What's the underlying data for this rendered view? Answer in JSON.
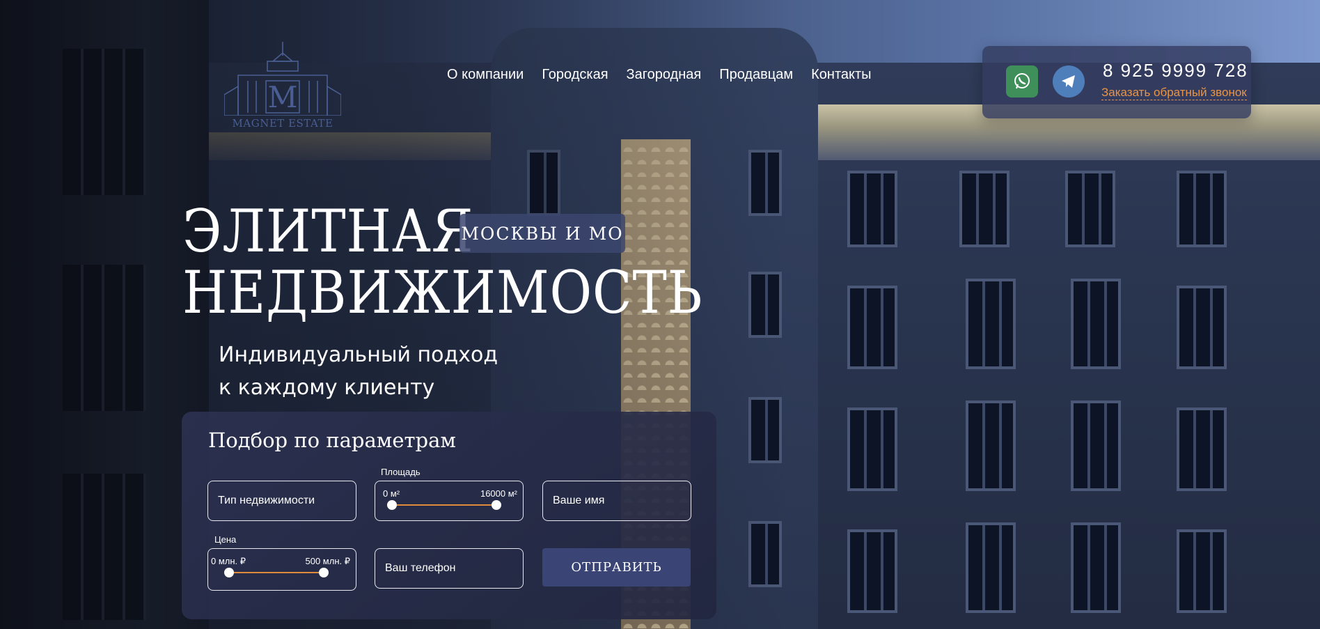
{
  "brand": {
    "logo_text": "MAGNET ESTATE"
  },
  "nav": {
    "items": [
      {
        "label": "О компании"
      },
      {
        "label": "Городская"
      },
      {
        "label": "Загородная"
      },
      {
        "label": "Продавцам"
      },
      {
        "label": "Контакты"
      }
    ]
  },
  "contact": {
    "phone": "8 925 9999 728",
    "callback": "Заказать обратный звонок",
    "icons": [
      "whatsapp-icon",
      "telegram-icon"
    ]
  },
  "hero": {
    "line1": "ЭЛИТНАЯ",
    "line2": "НЕДВИЖИМОСТЬ",
    "badge": "МОСКВЫ И МО",
    "sub1": "Индивидуальный подход",
    "sub2": "к каждому клиенту"
  },
  "filter": {
    "title": "Подбор по параметрам",
    "type_placeholder": "Тип недвижимости",
    "area": {
      "label": "Площадь",
      "min": "0 м²",
      "max": "16000 м²",
      "low": 0,
      "high": 16000
    },
    "price": {
      "label": "Цена",
      "min": "0 млн. ₽",
      "max": "500 млн. ₽",
      "low": 0,
      "high": 500
    },
    "name_placeholder": "Ваше имя",
    "phone_placeholder": "Ваш телефон",
    "submit_label": "ОТПРАВИТЬ"
  },
  "colors": {
    "accent_orange": "#e08a3c",
    "panel": "#2c3252",
    "button": "#3a4576"
  }
}
